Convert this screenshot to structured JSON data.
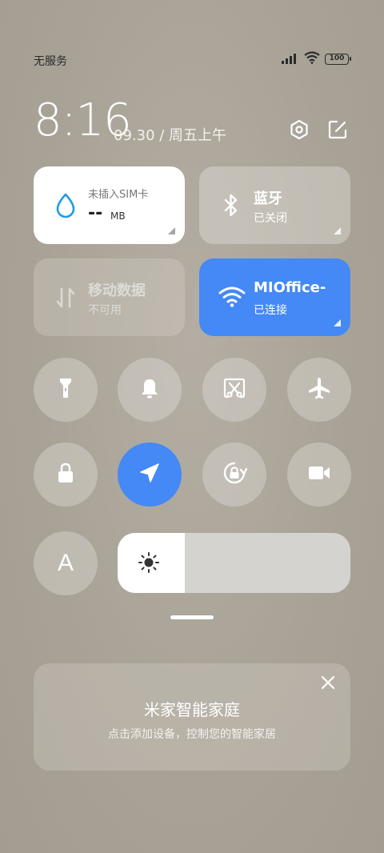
{
  "status": {
    "carrier": "无服务",
    "battery": "100"
  },
  "header": {
    "time": "8:16",
    "date": "09.30 / 周五上午"
  },
  "tiles": {
    "sim": {
      "title": "未插入SIM卡",
      "value": "--",
      "unit": "MB"
    },
    "bluetooth": {
      "title": "蓝牙",
      "status": "已关闭"
    },
    "mobile_data": {
      "title": "移动数据",
      "status": "不可用"
    },
    "wifi": {
      "title": "MIOffice-",
      "status": "已连接"
    }
  },
  "toggles_row1": [
    {
      "name": "flashlight",
      "active": false
    },
    {
      "name": "ringer",
      "active": false
    },
    {
      "name": "screenshot",
      "active": false
    },
    {
      "name": "airplane-mode",
      "active": false
    }
  ],
  "toggles_row2": [
    {
      "name": "lock-screen",
      "active": false
    },
    {
      "name": "location",
      "active": true
    },
    {
      "name": "rotation-lock",
      "active": false
    },
    {
      "name": "screen-record",
      "active": false
    }
  ],
  "auto_brightness_label": "A",
  "brightness_level": 0.29,
  "colors": {
    "accent": "#4489f5",
    "sim_drop": "#1e9be8"
  },
  "card": {
    "title": "米家智能家庭",
    "subtitle": "点击添加设备，控制您的智能家居"
  }
}
